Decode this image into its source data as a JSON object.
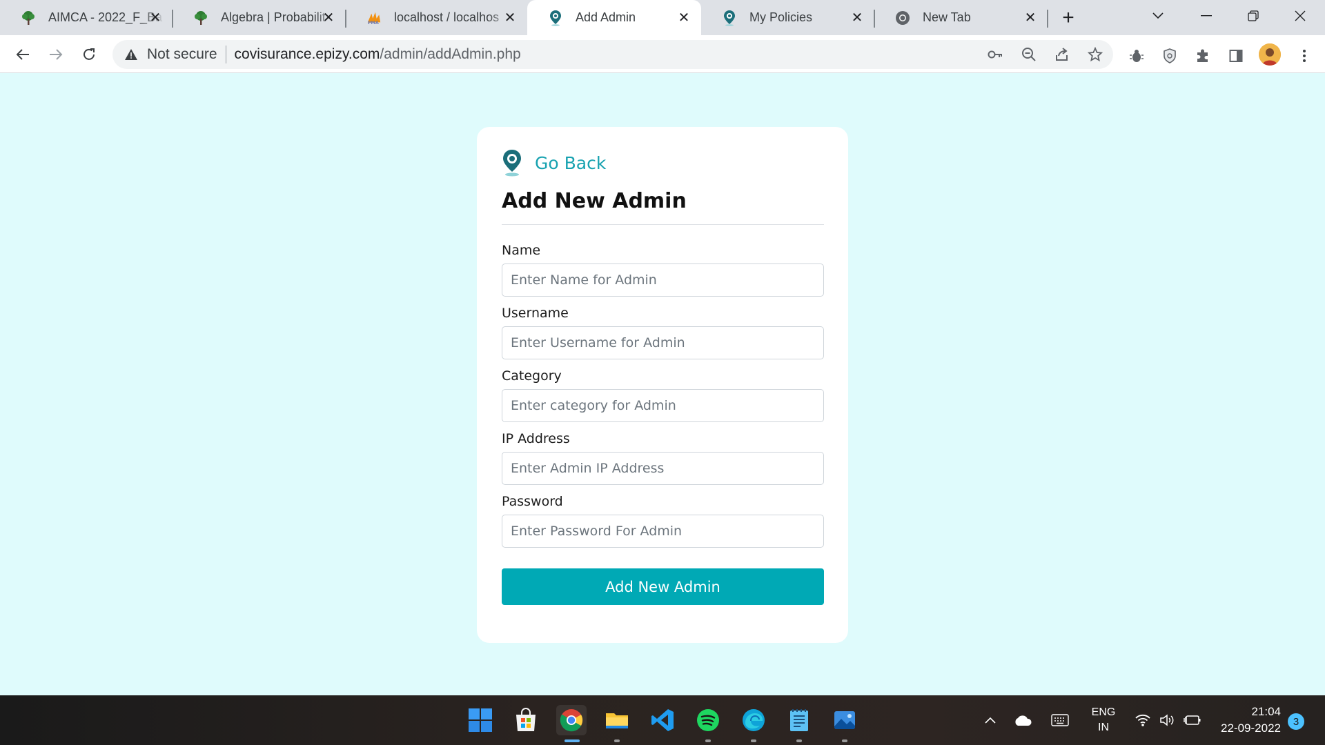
{
  "browser": {
    "tabs": [
      {
        "title": "AIMCA - 2022_F_Ba",
        "icon": "tree-favicon-icon"
      },
      {
        "title": "Algebra | Probabilit",
        "icon": "tree-favicon-icon"
      },
      {
        "title": "localhost / localhos",
        "icon": "phpmyadmin-icon"
      },
      {
        "title": "Add Admin",
        "icon": "covisurance-favicon-icon",
        "active": true
      },
      {
        "title": "My Policies",
        "icon": "covisurance-favicon-icon"
      },
      {
        "title": "New Tab",
        "icon": "chrome-icon"
      }
    ],
    "security_label": "Not secure",
    "url_host": "covisurance.epizy.com",
    "url_path": "/admin/addAdmin.php"
  },
  "page": {
    "go_back": "Go Back",
    "title": "Add New Admin",
    "fields": [
      {
        "label": "Name",
        "placeholder": "Enter Name for Admin",
        "value": ""
      },
      {
        "label": "Username",
        "placeholder": "Enter Username for Admin",
        "value": ""
      },
      {
        "label": "Category",
        "placeholder": "Enter category for Admin",
        "value": ""
      },
      {
        "label": "IP Address",
        "placeholder": "Enter Admin IP Address",
        "value": ""
      },
      {
        "label": "Password",
        "placeholder": "Enter Password For Admin",
        "value": ""
      }
    ],
    "submit_label": "Add New Admin",
    "accent_color": "#00a9b5",
    "background_color": "#dffbfc"
  },
  "taskbar": {
    "apps": [
      "windows-start-icon",
      "microsoft-store-icon",
      "chrome-icon",
      "file-explorer-icon",
      "vscode-icon",
      "spotify-icon",
      "edge-icon",
      "notepad-icon",
      "photos-icon"
    ],
    "language_line1": "ENG",
    "language_line2": "IN",
    "time": "21:04",
    "date": "22-09-2022",
    "notification_count": "3"
  }
}
